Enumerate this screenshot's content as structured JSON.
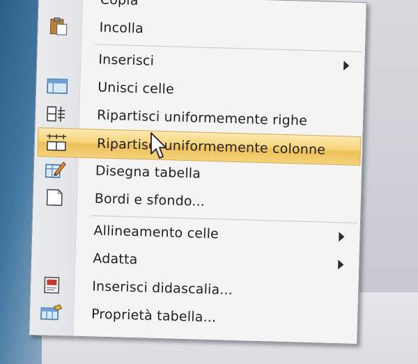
{
  "menu": {
    "items": [
      {
        "label": "Copia",
        "icon": "copy-icon",
        "has_submenu": false
      },
      {
        "label": "Incolla",
        "icon": "paste-icon",
        "has_submenu": false
      },
      {
        "label": "Inserisci",
        "icon": "",
        "has_submenu": true
      },
      {
        "label": "Unisci celle",
        "icon": "merge-cells-icon",
        "has_submenu": false
      },
      {
        "label": "Ripartisci uniformemente righe",
        "icon": "distribute-rows-icon",
        "has_submenu": false
      },
      {
        "label": "Ripartisci uniformemente colonne",
        "icon": "distribute-columns-icon",
        "has_submenu": false,
        "highlighted": true
      },
      {
        "label": "Disegna tabella",
        "icon": "draw-table-icon",
        "has_submenu": false
      },
      {
        "label": "Bordi e sfondo...",
        "icon": "borders-shading-icon",
        "has_submenu": false
      },
      {
        "label": "Allineamento celle",
        "icon": "",
        "has_submenu": true
      },
      {
        "label": "Adatta",
        "icon": "",
        "has_submenu": true
      },
      {
        "label": "Inserisci didascalia...",
        "icon": "insert-caption-icon",
        "has_submenu": false
      },
      {
        "label": "Proprietà tabella...",
        "icon": "table-properties-icon",
        "has_submenu": false
      }
    ]
  },
  "colors": {
    "highlight": "#f6d57a",
    "menu_bg": "#f4f4f5",
    "gutter": "#e6e7ea"
  }
}
